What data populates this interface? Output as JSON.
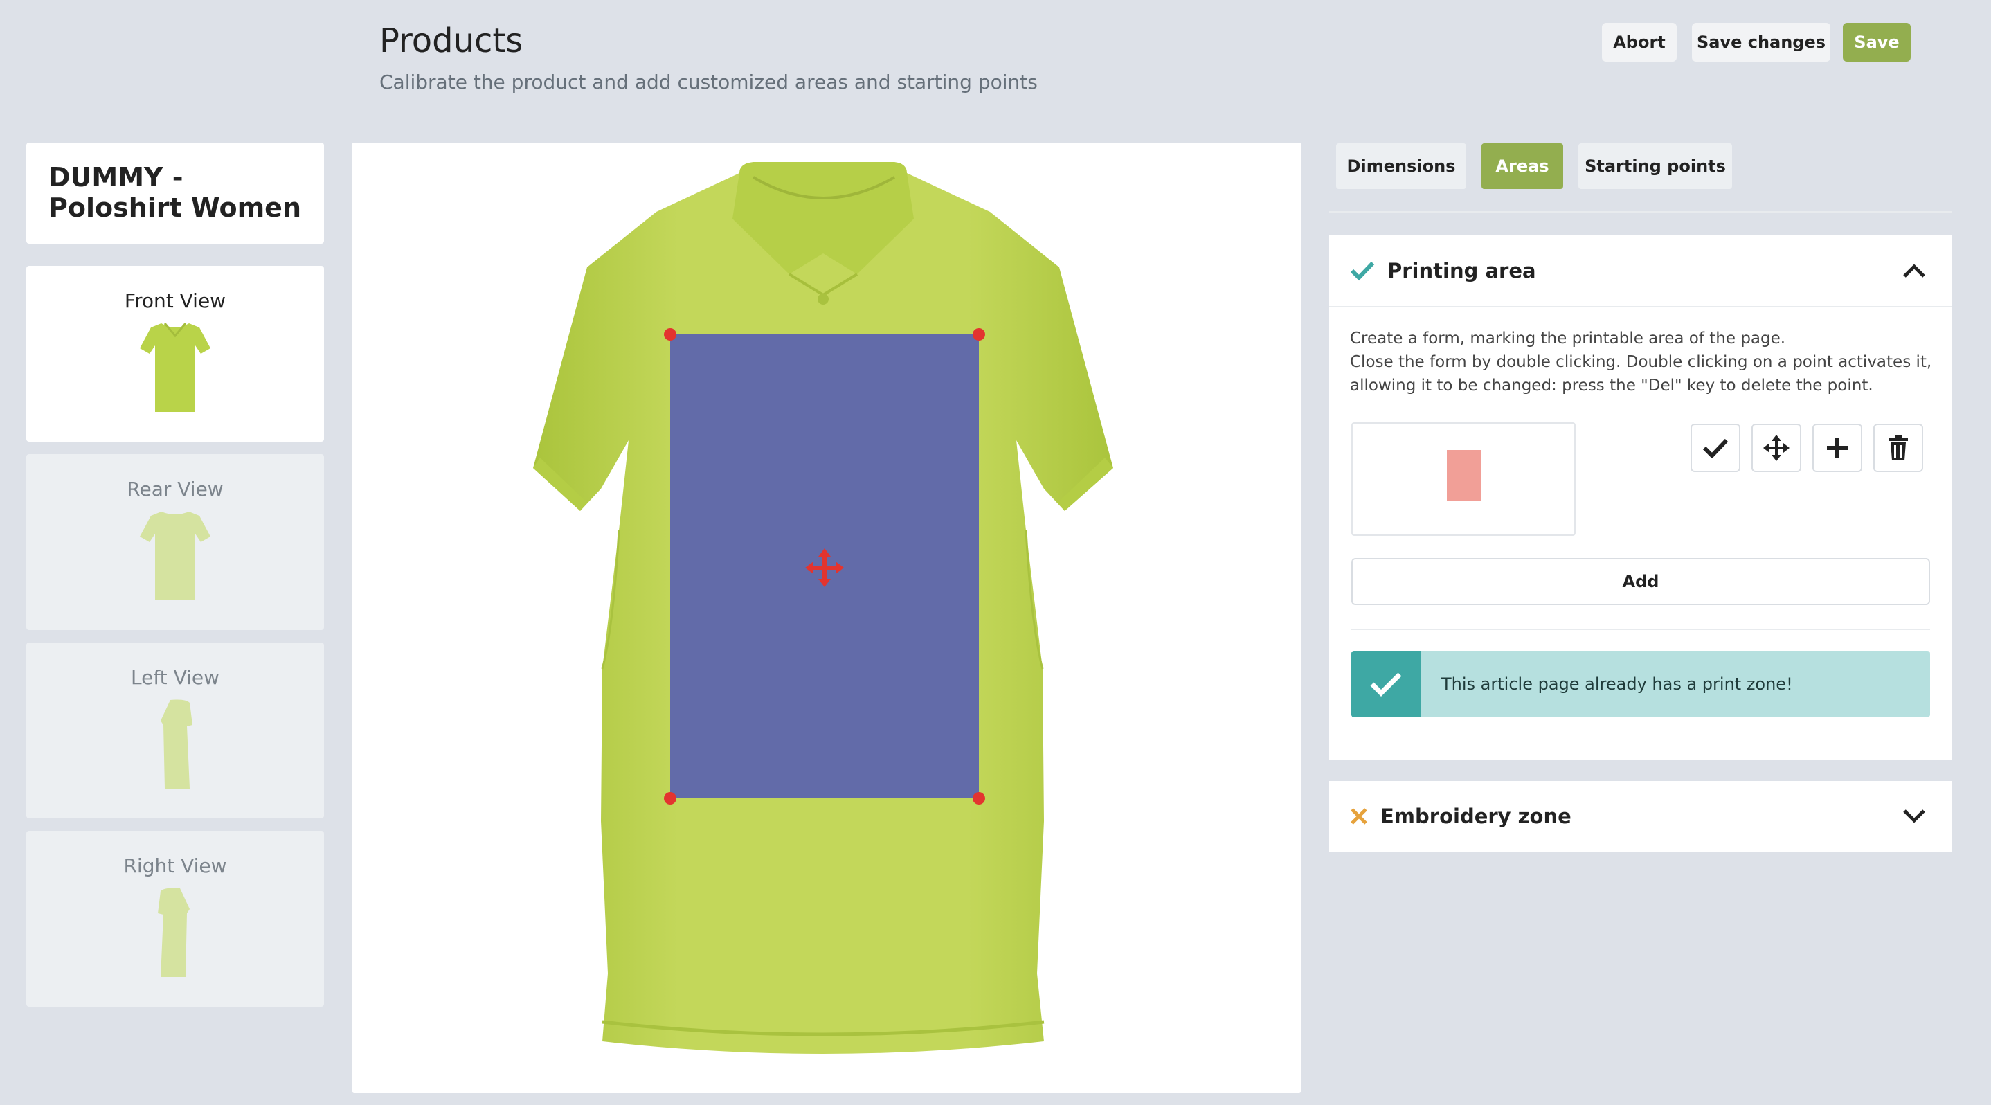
{
  "header": {
    "title": "Products",
    "subtitle": "Calibrate the product and add customized areas and starting points",
    "buttons": {
      "abort": "Abort",
      "save_changes": "Save changes",
      "save": "Save"
    }
  },
  "product": {
    "name": "DUMMY - Poloshirt Women"
  },
  "views": [
    {
      "label": "Front View",
      "active": true
    },
    {
      "label": "Rear View",
      "active": false
    },
    {
      "label": "Left View",
      "active": false
    },
    {
      "label": "Right View",
      "active": false
    }
  ],
  "tabs": [
    {
      "label": "Dimensions",
      "active": false
    },
    {
      "label": "Areas",
      "active": true
    },
    {
      "label": "Starting points",
      "active": false
    }
  ],
  "printing_area": {
    "title": "Printing area",
    "status": "complete",
    "help_lines": [
      "Create a form, marking the printable area of the page.",
      "Close the form by double clicking. Double clicking on a point activates it, allowing it to be changed: press the \"Del\" key to delete the point."
    ],
    "tools": [
      "check-icon",
      "move-icon",
      "plus-icon",
      "trash-icon"
    ],
    "add_label": "Add",
    "alert_text": "This article page already has a print zone!"
  },
  "embroidery_zone": {
    "title": "Embroidery zone",
    "status": "incomplete"
  },
  "colors": {
    "accent": "#93ae4f",
    "shirt": "#c3d75a",
    "print_area": "#5a62b0",
    "handle": "#e3342f",
    "alert_bg": "#b6e0df",
    "alert_icon": "#3ea8a4",
    "check_teal": "#3ea8a4",
    "cross_orange": "#e6a23c"
  }
}
